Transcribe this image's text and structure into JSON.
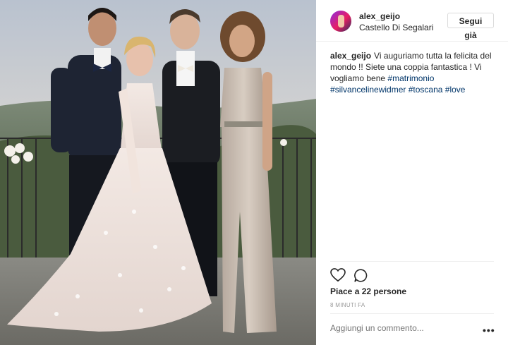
{
  "post": {
    "username": "alex_geijo",
    "location": "Castello Di Segalari",
    "follow_label": "Segui già",
    "caption": {
      "username": "alex_geijo",
      "text": "Vi auguriamo tutta la felicita del mondo !! Siete una coppia fantastica ! Vi vogliamo bene",
      "hashtags": [
        "#matrimonio",
        "#silvancelinewidmer",
        "#toscana",
        "#love"
      ]
    },
    "likes_text": "Piace a 22 persone",
    "time_text": "8 MINUTI FA",
    "comment_placeholder": "Aggiungi un commento...",
    "more_label": "•••"
  },
  "icons": {
    "like": "heart-icon",
    "comment": "comment-icon",
    "more": "more-options-icon"
  },
  "colors": {
    "text": "#262626",
    "hashtag": "#003569",
    "muted": "#999999",
    "border": "#efefef"
  }
}
